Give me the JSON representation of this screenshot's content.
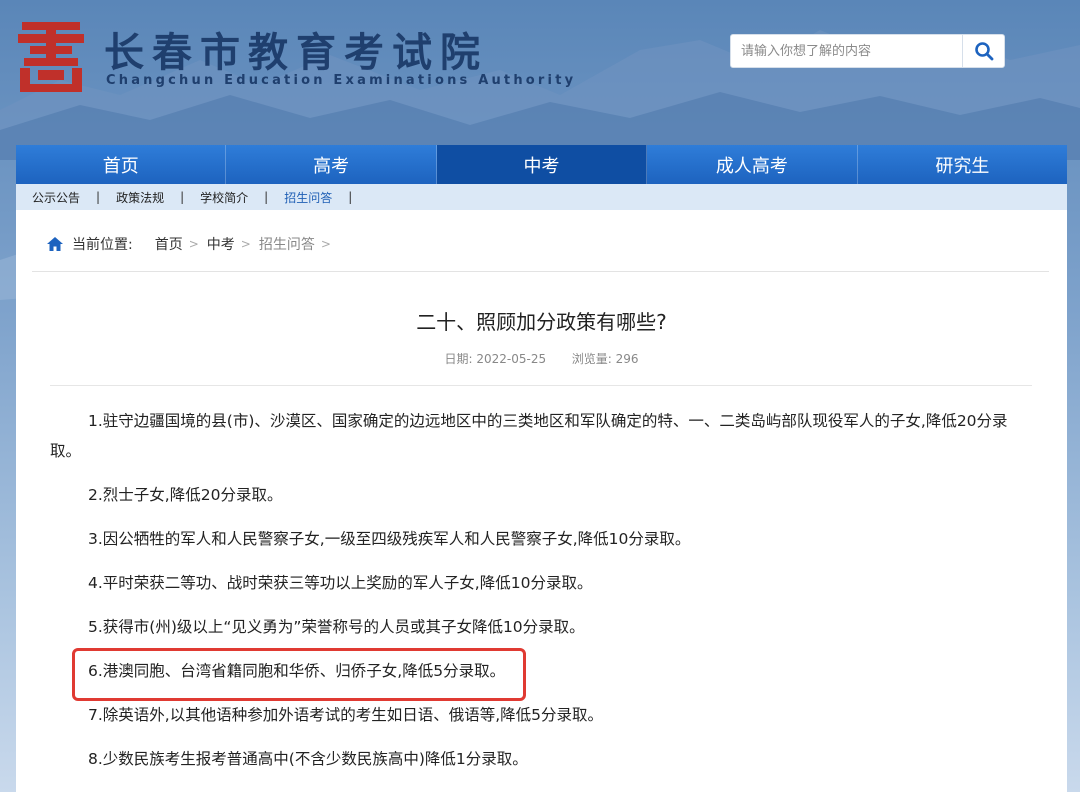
{
  "header": {
    "logo_icon": "seal-logo-icon",
    "title": "长春市教育考试院",
    "subtitle": "Changchun Education Examinations Authority",
    "search_placeholder": "请输入你想了解的内容",
    "search_icon": "search-icon"
  },
  "nav": {
    "items": [
      "首页",
      "高考",
      "中考",
      "成人高考",
      "研究生"
    ],
    "active_index": 2
  },
  "subnav": {
    "items": [
      "公示公告",
      "政策法规",
      "学校简介",
      "招生问答"
    ],
    "separator": "|",
    "active_index": 3
  },
  "breadcrumb": {
    "label": "当前位置:",
    "items": [
      "首页",
      "中考",
      "招生问答"
    ],
    "sep": ">"
  },
  "article": {
    "title": "二十、照顾加分政策有哪些?",
    "date_label": "日期:",
    "date": "2022-05-25",
    "views_label": "浏览量:",
    "views": "296",
    "paragraphs": [
      "1.驻守边疆国境的县(市)、沙漠区、国家确定的边远地区中的三类地区和军队确定的特、一、二类岛屿部队现役军人的子女,降低20分录取。",
      "2.烈士子女,降低20分录取。",
      "3.因公牺牲的军人和人民警察子女,一级至四级残疾军人和人民警察子女,降低10分录取。",
      "4.平时荣获二等功、战时荣获三等功以上奖励的军人子女,降低10分录取。",
      "5.获得市(州)级以上“见义勇为”荣誉称号的人员或其子女降低10分录取。",
      "6.港澳同胞、台湾省籍同胞和华侨、归侨子女,降低5分录取。",
      "7.除英语外,以其他语种参加外语考试的考生如日语、俄语等,降低5分录取。",
      "8.少数民族考生报考普通高中(不含少数民族高中)降低1分录取。"
    ],
    "highlighted_paragraph_index": 5
  },
  "colors": {
    "nav_blue": "#1d63bf",
    "nav_active": "#0f4ea3",
    "subnav_bg": "#dbe8f6",
    "logo_red": "#c0302a",
    "highlight_red": "#e03a32",
    "title_navy": "#1f3f6e"
  }
}
